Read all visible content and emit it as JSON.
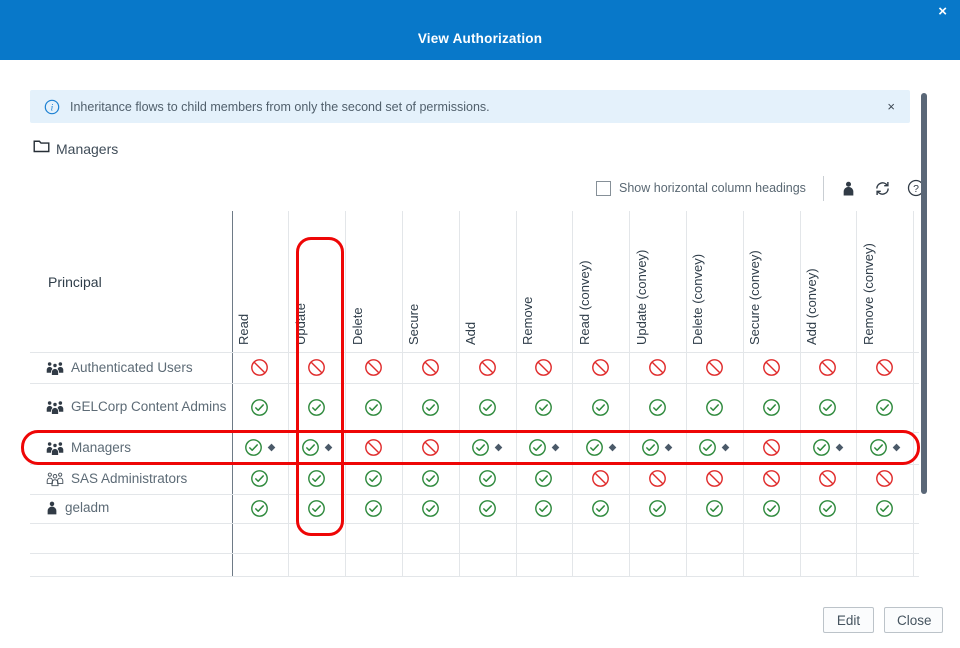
{
  "dialog": {
    "title": "View Authorization",
    "close_glyph": "×"
  },
  "banner": {
    "info_glyph": "i",
    "text": "Inheritance flows to child members from only the second set of permissions.",
    "dismiss_glyph": "×"
  },
  "context": {
    "folder_label": "Managers"
  },
  "toolbar": {
    "checkbox_label": "Show horizontal column headings",
    "checkbox_checked": false,
    "help_glyph": "?"
  },
  "matrix": {
    "principal_header": "Principal",
    "columns": [
      "Read",
      "Update",
      "Delete",
      "Secure",
      "Add",
      "Remove",
      "Read (convey)",
      "Update (convey)",
      "Delete (convey)",
      "Secure (convey)",
      "Add (convey)",
      "Remove (convey)"
    ],
    "rows": [
      {
        "name": "Authenticated Users",
        "icon": "group-filled",
        "cells": [
          "deny",
          "deny",
          "deny",
          "deny",
          "deny",
          "deny",
          "deny",
          "deny",
          "deny",
          "deny",
          "deny",
          "deny"
        ]
      },
      {
        "name": "GELCorp Content Admins",
        "icon": "group-filled",
        "cells": [
          "allow",
          "allow",
          "allow",
          "allow",
          "allow",
          "allow",
          "allow",
          "allow",
          "allow",
          "allow",
          "allow",
          "allow"
        ]
      },
      {
        "name": "Managers",
        "icon": "group-filled",
        "highlighted": true,
        "cells": [
          "allow-diamond",
          "allow-diamond",
          "deny",
          "deny",
          "allow-diamond",
          "allow-diamond",
          "allow-diamond",
          "allow-diamond",
          "allow-diamond",
          "deny",
          "allow-diamond",
          "allow-diamond"
        ]
      },
      {
        "name": "SAS Administrators",
        "icon": "group-outline",
        "cells": [
          "allow",
          "allow",
          "allow",
          "allow",
          "allow",
          "allow",
          "deny",
          "deny",
          "deny",
          "deny",
          "deny",
          "deny"
        ]
      },
      {
        "name": "geladm",
        "icon": "person",
        "cells": [
          "allow",
          "allow",
          "allow",
          "allow",
          "allow",
          "allow",
          "allow",
          "allow",
          "allow",
          "allow",
          "allow",
          "allow"
        ]
      }
    ]
  },
  "highlights": {
    "highlighted_column": "Update",
    "highlighted_row": "Managers",
    "color": "#ee0606"
  },
  "footer": {
    "edit_label": "Edit",
    "close_label": "Close"
  },
  "colors": {
    "titlebar_bg": "#0878c9",
    "banner_bg": "#e4f1fb",
    "allow_green": "#2f8a3d",
    "deny_red": "#e02b2b",
    "diamond_slate": "#4b5a69",
    "highlight_red": "#ee0606"
  }
}
